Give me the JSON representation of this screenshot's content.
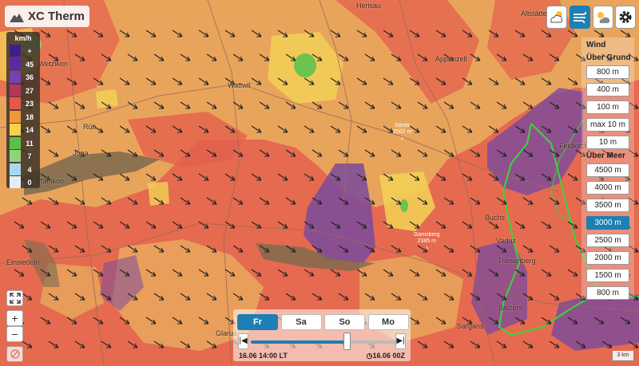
{
  "app": {
    "name": "XC Therm"
  },
  "legend": {
    "title": "km/h",
    "rows": [
      {
        "label": "+",
        "color": "#3d1f8c"
      },
      {
        "label": "45",
        "color": "#5a2aa6"
      },
      {
        "label": "36",
        "color": "#7a3fb0"
      },
      {
        "label": "27",
        "color": "#b2375a"
      },
      {
        "label": "23",
        "color": "#e8564a"
      },
      {
        "label": "18",
        "color": "#f0983e"
      },
      {
        "label": "14",
        "color": "#f5d24a"
      },
      {
        "label": "11",
        "color": "#5bbf48"
      },
      {
        "label": "7",
        "color": "#8fd47a"
      },
      {
        "label": "4",
        "color": "#a8d8f0"
      },
      {
        "label": "0",
        "color": "#e2eef6"
      }
    ]
  },
  "top_buttons": [
    {
      "name": "cloud-sun-icon",
      "active": false
    },
    {
      "name": "wind-icon",
      "active": true
    },
    {
      "name": "sun-cloud-icon",
      "active": false
    },
    {
      "name": "gear-icon",
      "active": false
    }
  ],
  "wind_panel": {
    "title": "Wind",
    "group_agl": "Über Grund",
    "agl_levels": [
      "800 m",
      "400 m",
      "100 m",
      "max 10 m",
      "10 m"
    ],
    "group_amsl": "Über Meer",
    "amsl_levels": [
      "4500 m",
      "4000 m",
      "3500 m",
      "3000 m",
      "2500 m",
      "2000 m",
      "1500 m",
      "800 m"
    ],
    "selected": "3000 m"
  },
  "places": [
    {
      "name": "Herisau"
    },
    {
      "name": "Altstätten"
    },
    {
      "name": "Wetzikon"
    },
    {
      "name": "Appenzell"
    },
    {
      "name": "Wattwil"
    },
    {
      "name": "Rüti"
    },
    {
      "name": "Jona"
    },
    {
      "name": "Pfäffikon"
    },
    {
      "name": "Feldkirch"
    },
    {
      "name": "Buchs"
    },
    {
      "name": "Vaduz"
    },
    {
      "name": "Triesenberg"
    },
    {
      "name": "Einsiedeln"
    },
    {
      "name": "Balzers"
    },
    {
      "name": "Sargans"
    },
    {
      "name": "Glarus"
    }
  ],
  "peaks": [
    {
      "name": "Säntis",
      "elev": "2502 m"
    },
    {
      "name": "Gamsberg",
      "elev": "2385 m"
    }
  ],
  "timebar": {
    "days": [
      "Fr",
      "Sa",
      "So",
      "Mo"
    ],
    "selected_day": "Fr",
    "progress": 0.65,
    "local_time": "16.06 14:00 LT",
    "model_run": "16.06 00Z"
  },
  "scale_label": "3 km",
  "colors": {
    "accent": "#1d7fb3",
    "border": "#3bd43b"
  }
}
